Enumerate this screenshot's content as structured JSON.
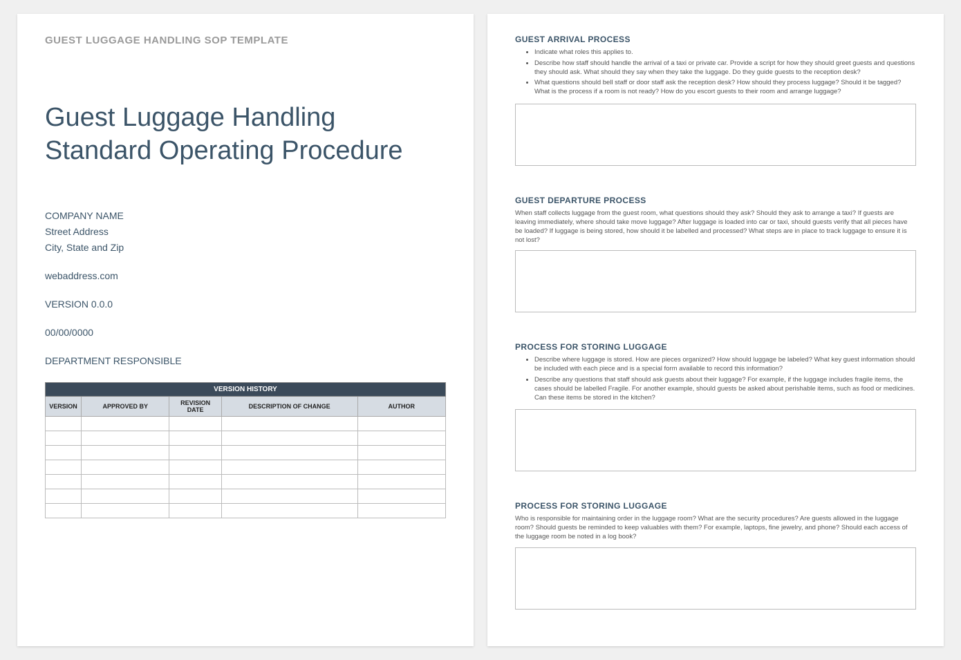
{
  "template_header": "GUEST LUGGAGE HANDLING SOP TEMPLATE",
  "doc_title": "Guest Luggage Handling Standard Operating Procedure",
  "meta": {
    "company": "COMPANY NAME",
    "street": "Street Address",
    "citystatezip": "City, State and Zip",
    "web": "webaddress.com",
    "version": "VERSION 0.0.0",
    "date": "00/00/0000",
    "dept": "DEPARTMENT RESPONSIBLE"
  },
  "version_history": {
    "title": "VERSION HISTORY",
    "columns": [
      "VERSION",
      "APPROVED BY",
      "REVISION DATE",
      "DESCRIPTION OF CHANGE",
      "AUTHOR"
    ],
    "rows": 7
  },
  "sections": {
    "arrival": {
      "heading": "GUEST ARRIVAL PROCESS",
      "bullets": [
        "Indicate what roles this applies to.",
        "Describe how staff should handle the arrival of a taxi or private car. Provide a script for how they should greet guests and questions they should ask. What should they say when they take the luggage. Do they guide guests to the reception desk?",
        "What questions should bell staff or door staff ask the reception desk? How should they process luggage? Should it be tagged? What is the process if a room is not ready? How do you escort guests to their room and arrange luggage?"
      ]
    },
    "departure": {
      "heading": "GUEST DEPARTURE PROCESS",
      "text": "When staff collects luggage from the guest room, what questions should they ask? Should they ask to arrange a taxi? If guests are leaving immediately, where should take move luggage? After luggage is loaded into car or taxi, should guests verify that all pieces have be loaded? If luggage is being stored, how should it be labelled and processed? What steps are in place to track luggage to ensure it is not lost?"
    },
    "storing1": {
      "heading": "PROCESS FOR STORING LUGGAGE",
      "bullets": [
        "Describe where luggage is stored. How are pieces organized? How should luggage be labeled? What key guest information should be included with each piece and is a special form available to record this information?",
        "Describe any questions that staff should ask guests about their luggage? For example, if the luggage includes fragile items, the cases should be labelled Fragile. For another example, should guests be asked about perishable items, such as food or medicines. Can these items be stored in the kitchen?"
      ]
    },
    "storing2": {
      "heading": "PROCESS FOR STORING LUGGAGE",
      "text": "Who is responsible for maintaining order in the luggage room? What are the security procedures? Are guests allowed in the luggage room? Should guests be reminded to keep valuables with them? For example, laptops, fine jewelry, and phone? Should each access of the luggage room be noted in a log book?"
    }
  }
}
